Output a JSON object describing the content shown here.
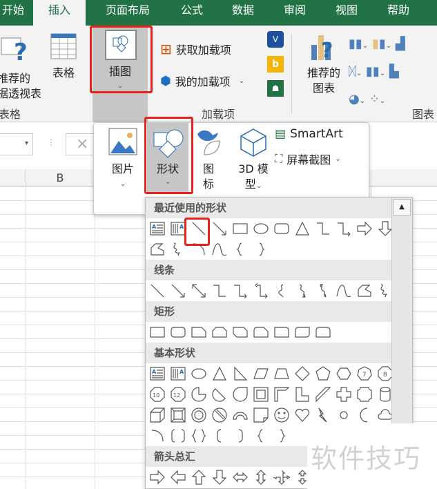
{
  "tabs": [
    {
      "label": "开始",
      "selected": false
    },
    {
      "label": "插入",
      "selected": true
    },
    {
      "label": "页面布局",
      "selected": false
    },
    {
      "label": "公式",
      "selected": false
    },
    {
      "label": "数据",
      "selected": false
    },
    {
      "label": "审阅",
      "selected": false
    },
    {
      "label": "视图",
      "selected": false
    },
    {
      "label": "帮助",
      "selected": false
    }
  ],
  "ribbon": {
    "pivot_label_1": "推荐的",
    "pivot_label_2": "数据透视表",
    "table_label": "表格",
    "group_tables": "表格",
    "illustrations_label": "插图",
    "get_addins": "获取加载项",
    "my_addins": "我的加载项",
    "group_addins": "加载项",
    "rec_charts_1": "推荐的",
    "rec_charts_2": "图表",
    "group_charts": "图表"
  },
  "formula_bar": {
    "cancel_icon": "×"
  },
  "columns": [
    "B"
  ],
  "illustrations_menu": {
    "pictures": "图片",
    "shapes": "形状",
    "icons_1": "图",
    "icons_2": "标",
    "model_1": "3D 模",
    "model_2": "型",
    "smartart": "SmartArt",
    "screenshot": "屏幕截图"
  },
  "gallery": {
    "sections": [
      {
        "title": "最近使用的形状",
        "rows": [
          [
            "textbox",
            "vtextbox",
            "line",
            "arrow",
            "rect",
            "ellipse",
            "roundrect",
            "triangle",
            "elbow",
            "elbowarrow",
            "rightarrow",
            "downarrow"
          ],
          [
            "freeform",
            "scribble",
            "arc",
            "wave",
            "lbrace",
            "rbrace"
          ]
        ]
      },
      {
        "title": "线条",
        "rows": [
          [
            "line",
            "arrow",
            "dblarrow",
            "elbow",
            "elbowarrow",
            "elbowdbl",
            "curve",
            "curvearrow",
            "curvedbl",
            "wave",
            "freeform",
            "scribble"
          ]
        ]
      },
      {
        "title": "矩形",
        "rows": [
          [
            "rect",
            "roundrect",
            "snip1",
            "snip2",
            "snipdiag",
            "snipround",
            "roundsingle",
            "rounddiag",
            "roundsame"
          ]
        ]
      },
      {
        "title": "基本形状",
        "rows": [
          [
            "textbox",
            "vtextbox",
            "ellipse",
            "triangle",
            "rtriangle",
            "parallelogram",
            "trapezoid",
            "diamond",
            "pentagon",
            "hexagon",
            "heptagon",
            "octagon"
          ],
          [
            "decagon",
            "dodecagon",
            "pie",
            "chord",
            "teardrop",
            "frame",
            "halfframe",
            "lshape",
            "diagstripe",
            "plus",
            "plaque",
            "can"
          ],
          [
            "cube",
            "bevel",
            "donut",
            "nosymbol",
            "blockarc",
            "foldedcorner",
            "smiley",
            "heart",
            "lightning",
            "sun",
            "moon",
            "cloud"
          ],
          [
            "arc",
            "bracketpair",
            "bracepair",
            "lbracket",
            "rbracket",
            "lbrace",
            "rbrace"
          ]
        ]
      },
      {
        "title": "箭头总汇",
        "rows": [
          [
            "rightarrow",
            "leftarrow",
            "uparrow",
            "downarrow",
            "lrarrow",
            "udarrow",
            "quadarrow",
            "lrudarrow"
          ]
        ]
      }
    ]
  },
  "watermark": "软件技巧",
  "colors": {
    "accent": "#217346",
    "highlight": "#e8231b"
  }
}
